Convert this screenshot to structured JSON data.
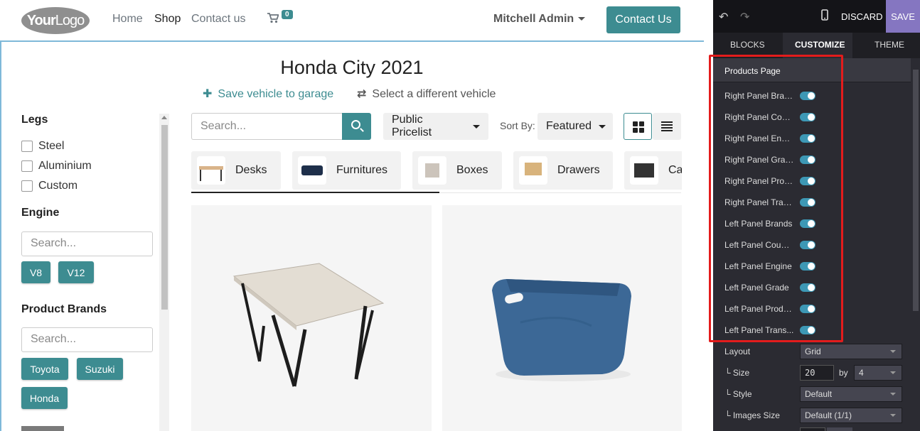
{
  "site": {
    "logo": {
      "bold": "Your",
      "thin": "Logo"
    },
    "nav": [
      {
        "label": "Home"
      },
      {
        "label": "Shop"
      },
      {
        "label": "Contact us"
      }
    ],
    "cart_count": "0",
    "user": "Mitchell Admin",
    "contact_button": "Contact Us",
    "page_title": "Honda City 2021",
    "save_vehicle": "Save vehicle to garage",
    "select_vehicle": "Select a different vehicle",
    "sidebar": {
      "legs_title": "Legs",
      "legs": [
        "Steel",
        "Aluminium",
        "Custom"
      ],
      "engine_title": "Engine",
      "engine_search_placeholder": "Search...",
      "engine_tags": [
        "V8",
        "V12"
      ],
      "brands_title": "Product Brands",
      "brands_search_placeholder": "Search...",
      "brand_tags": [
        "Toyota",
        "Suzuki",
        "Honda"
      ]
    },
    "toolbar": {
      "search_placeholder": "Search...",
      "pricelist": "Public Pricelist",
      "sort_label": "Sort By:",
      "sort_value": "Featured"
    },
    "categories": [
      "Desks",
      "Furnitures",
      "Boxes",
      "Drawers",
      "Ca"
    ]
  },
  "panel": {
    "discard": "DISCARD",
    "save": "SAVE",
    "tabs": [
      "BLOCKS",
      "CUSTOMIZE",
      "THEME"
    ],
    "section_title": "Products Page",
    "toggles": [
      "Right Panel Brands",
      "Right Panel Country",
      "Right Panel Engine",
      "Right Panel Grade",
      "Right Panel Products",
      "Right Panel Transmission",
      "Left Panel Brands",
      "Left Panel Country",
      "Left Panel Engine",
      "Left Panel Grade",
      "Left Panel Products",
      "Left Panel Transmission"
    ],
    "toggle_display": [
      "Right Panel Bran...",
      "Right Panel Coun...",
      "Right Panel Engine",
      "Right Panel Grade",
      "Right Panel Prod...",
      "Right Panel Tran...",
      "Left Panel Brands",
      "Left Panel Country",
      "Left Panel Engine",
      "Left Panel Grade",
      "Left Panel Produ...",
      "Left Panel Trans..."
    ],
    "toggle_on": [
      true,
      true,
      true,
      true,
      true,
      true,
      true,
      true,
      true,
      true,
      true,
      true
    ],
    "layout_label": "Layout",
    "layout_value": "Grid",
    "size_label": "└ Size",
    "size_value": "20",
    "size_by": "by",
    "size_cols": "4",
    "style_label": "└ Style",
    "style_value": "Default",
    "images_label": "└ Images Size",
    "images_value": "Default (1/1)"
  },
  "colors": {
    "accent": "#3d8c91",
    "panel_bg": "#2b2b32",
    "save_bg": "#8576c1",
    "highlight": "#e31c1c",
    "toggle_on": "#3d98b5"
  }
}
